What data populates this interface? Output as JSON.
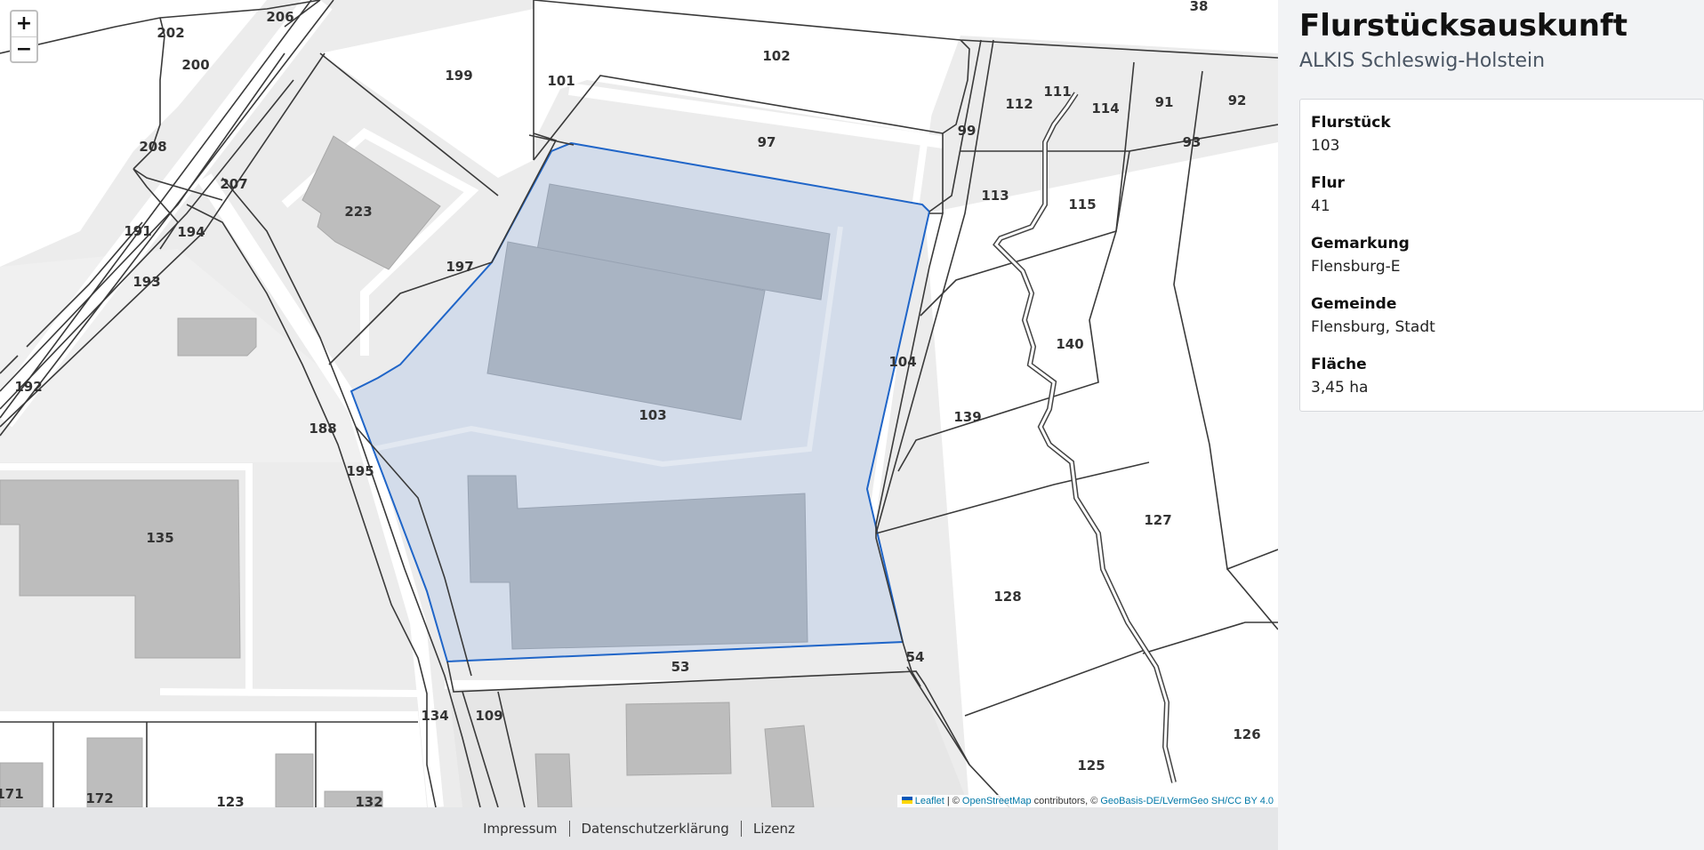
{
  "map": {
    "zoom_in": "+",
    "zoom_out": "−",
    "selected_parcel": "103",
    "highlight_color": "#1f65c8",
    "parcel_labels": [
      "206",
      "202",
      "200",
      "208",
      "191",
      "194",
      "193",
      "192",
      "207",
      "223",
      "199",
      "101",
      "102",
      "97",
      "38",
      "112",
      "111",
      "114",
      "91",
      "92",
      "93",
      "99",
      "113",
      "115",
      "197",
      "104",
      "140",
      "139",
      "188",
      "195",
      "103",
      "127",
      "128",
      "135",
      "53",
      "54",
      "126",
      "125",
      "134",
      "109",
      "171",
      "172",
      "123",
      "132"
    ],
    "attribution": {
      "leaflet": "Leaflet",
      "osm_prefix": " | © ",
      "osm": "OpenStreetMap",
      "osm_suffix": " contributors, © ",
      "geobasis": "GeoBasis-DE/LVermGeo SH/CC BY 4.0"
    }
  },
  "footer": {
    "impressum": "Impressum",
    "datenschutz": "Datenschutzerklärung",
    "lizenz": "Lizenz"
  },
  "sidebar": {
    "title": "Flurstücksauskunft",
    "subtitle": "ALKIS Schleswig-Holstein",
    "fields": [
      {
        "label": "Flurstück",
        "value": "103"
      },
      {
        "label": "Flur",
        "value": "41"
      },
      {
        "label": "Gemarkung",
        "value": "Flensburg-E"
      },
      {
        "label": "Gemeinde",
        "value": "Flensburg, Stadt"
      },
      {
        "label": "Fläche",
        "value": "3,45 ha"
      }
    ]
  }
}
